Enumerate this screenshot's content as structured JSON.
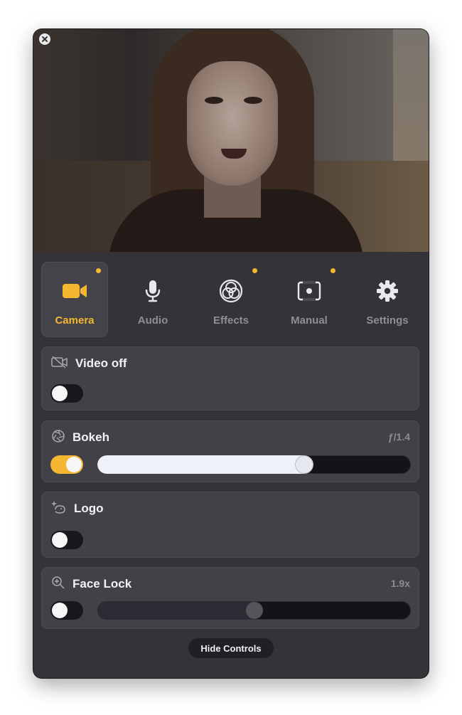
{
  "tabs": [
    {
      "label": "Camera",
      "icon": "video-camera-icon",
      "active": true,
      "dot": true
    },
    {
      "label": "Audio",
      "icon": "microphone-icon",
      "active": false,
      "dot": false
    },
    {
      "label": "Effects",
      "icon": "effects-circles-icon",
      "active": false,
      "dot": true
    },
    {
      "label": "Manual",
      "icon": "manual-frame-icon",
      "active": false,
      "dot": true
    },
    {
      "label": "Settings",
      "icon": "gear-icon",
      "active": false,
      "dot": false
    }
  ],
  "controls": {
    "video_off": {
      "title": "Video off",
      "icon": "video-off-icon",
      "enabled": false
    },
    "bokeh": {
      "title": "Bokeh",
      "icon": "aperture-icon",
      "value": "ƒ/1.4",
      "enabled": true,
      "slider_level": 0.67
    },
    "logo": {
      "title": "Logo",
      "icon": "logo-sparkle-icon",
      "enabled": false
    },
    "face_lock": {
      "title": "Face Lock",
      "icon": "zoom-in-icon",
      "value": "1.9x",
      "enabled": false,
      "slider_level": 0.5
    }
  },
  "hide_controls_label": "Hide Controls",
  "colors": {
    "accent": "#f5b731",
    "window_bg": "#333338",
    "card_bg": "#414147",
    "inactive_text": "#8e8e93"
  }
}
